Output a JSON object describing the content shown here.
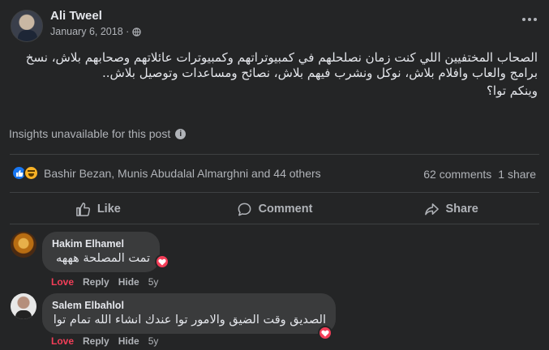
{
  "post": {
    "author": "Ali Tweel",
    "date": "January 6, 2018 · ",
    "text_line1": "الصحاب المختفيين اللي كنت زمان نصلحلهم في كمبيوتراتهم وكمبيوترات عائلاتهم وصحابهم بلاش، نسخ برامج والعاب وافلام بلاش، نوكل ونشرب فيهم بلاش، نصائح ومساعدات وتوصيل بلاش..",
    "text_line2": "وينكم توا؟",
    "insights": "Insights unavailable for this post",
    "reactions_names": "Bashir Bezan, Munis Abudalal Almarghni and 44 others",
    "comments_count": "62 comments",
    "shares_count": "1 share"
  },
  "actions": {
    "like": "Like",
    "comment": "Comment",
    "share": "Share"
  },
  "comments": [
    {
      "author": "Hakim Elhamel",
      "text": "تمت المصلحة هههه",
      "reaction": "Love",
      "reply": "Reply",
      "hide": "Hide",
      "age": "5y"
    },
    {
      "author": "Salem Elbahlol",
      "text": "الصديق وقت الضيق والامور توا عندك انشاء الله تمام توا",
      "reaction": "Love",
      "reply": "Reply",
      "hide": "Hide",
      "age": "5y"
    }
  ],
  "colors": {
    "background": "#242526",
    "love": "#f33e58",
    "like": "#1877f2",
    "haha": "#f7b125"
  }
}
